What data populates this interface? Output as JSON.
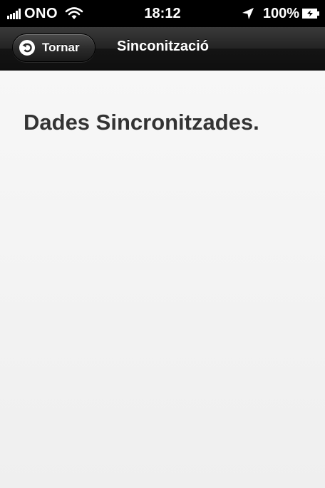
{
  "status_bar": {
    "carrier": "ONO",
    "time": "18:12",
    "battery": "100%"
  },
  "nav_bar": {
    "back_label": "Tornar",
    "title": "Sinconització"
  },
  "content": {
    "message": "Dades Sincronitzades."
  },
  "icons": {
    "signal": "signal-bars-icon",
    "wifi": "wifi-icon",
    "location": "location-arrow-icon",
    "battery": "battery-charging-icon",
    "back": "back-arrow-icon"
  },
  "colors": {
    "status_bar_bg": "#000000",
    "nav_bar_bg": "#1a1a1a",
    "content_bg": "#f4f4f4",
    "message_text": "#333333"
  }
}
